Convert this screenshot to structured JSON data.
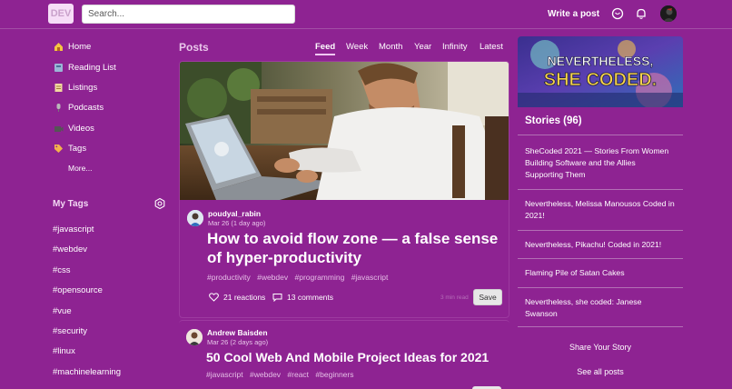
{
  "header": {
    "logo_text": "DEV",
    "search_placeholder": "Search...",
    "write_post": "Write a post"
  },
  "sidebar": {
    "items": [
      {
        "label": "Home",
        "icon": "house-icon"
      },
      {
        "label": "Reading List",
        "icon": "bookmark-icon"
      },
      {
        "label": "Listings",
        "icon": "scroll-icon"
      },
      {
        "label": "Podcasts",
        "icon": "microphone-icon"
      },
      {
        "label": "Videos",
        "icon": "camera-icon"
      },
      {
        "label": "Tags",
        "icon": "tag-icon"
      }
    ],
    "more": "More...",
    "my_tags_title": "My Tags",
    "tags": [
      "#javascript",
      "#webdev",
      "#css",
      "#opensource",
      "#vue",
      "#security",
      "#linux",
      "#machinelearning"
    ]
  },
  "feed": {
    "title": "Posts",
    "tabs": [
      "Feed",
      "Week",
      "Month",
      "Year",
      "Infinity",
      "Latest"
    ],
    "active_tab": "Feed"
  },
  "posts": [
    {
      "author": "poudyal_rabin",
      "date": "Mar 26 (1 day ago)",
      "title": "How to avoid flow zone — a false sense of hyper-productivity",
      "tags": [
        "#productivity",
        "#webdev",
        "#programming",
        "#javascript"
      ],
      "reactions": "21 reactions",
      "comments": "13 comments",
      "read_time": "3 min read",
      "save": "Save"
    },
    {
      "author": "Andrew Baisden",
      "date": "Mar 26 (2 days ago)",
      "title": "50 Cool Web And Mobile Project Ideas for 2021",
      "tags": [
        "#javascript",
        "#webdev",
        "#react",
        "#beginners"
      ]
    }
  ],
  "right": {
    "banner_line1": "NEVERTHELESS,",
    "banner_line2": "SHE CODED.",
    "stories_title": "Stories (96)",
    "stories": [
      "SheCoded 2021 — Stories From Women Building Software and the Allies Supporting Them",
      "Nevertheless, Melissa Manousos Coded in 2021!",
      "Nevertheless, Pikachu! Coded in 2021!",
      "Flaming Pile of Satan Cakes",
      "Nevertheless, she coded: Janese Swanson"
    ],
    "share": "Share Your Story",
    "see_all": "See all posts"
  },
  "colors": {
    "background": "#8e2392",
    "accent": "#f0c7f2"
  }
}
